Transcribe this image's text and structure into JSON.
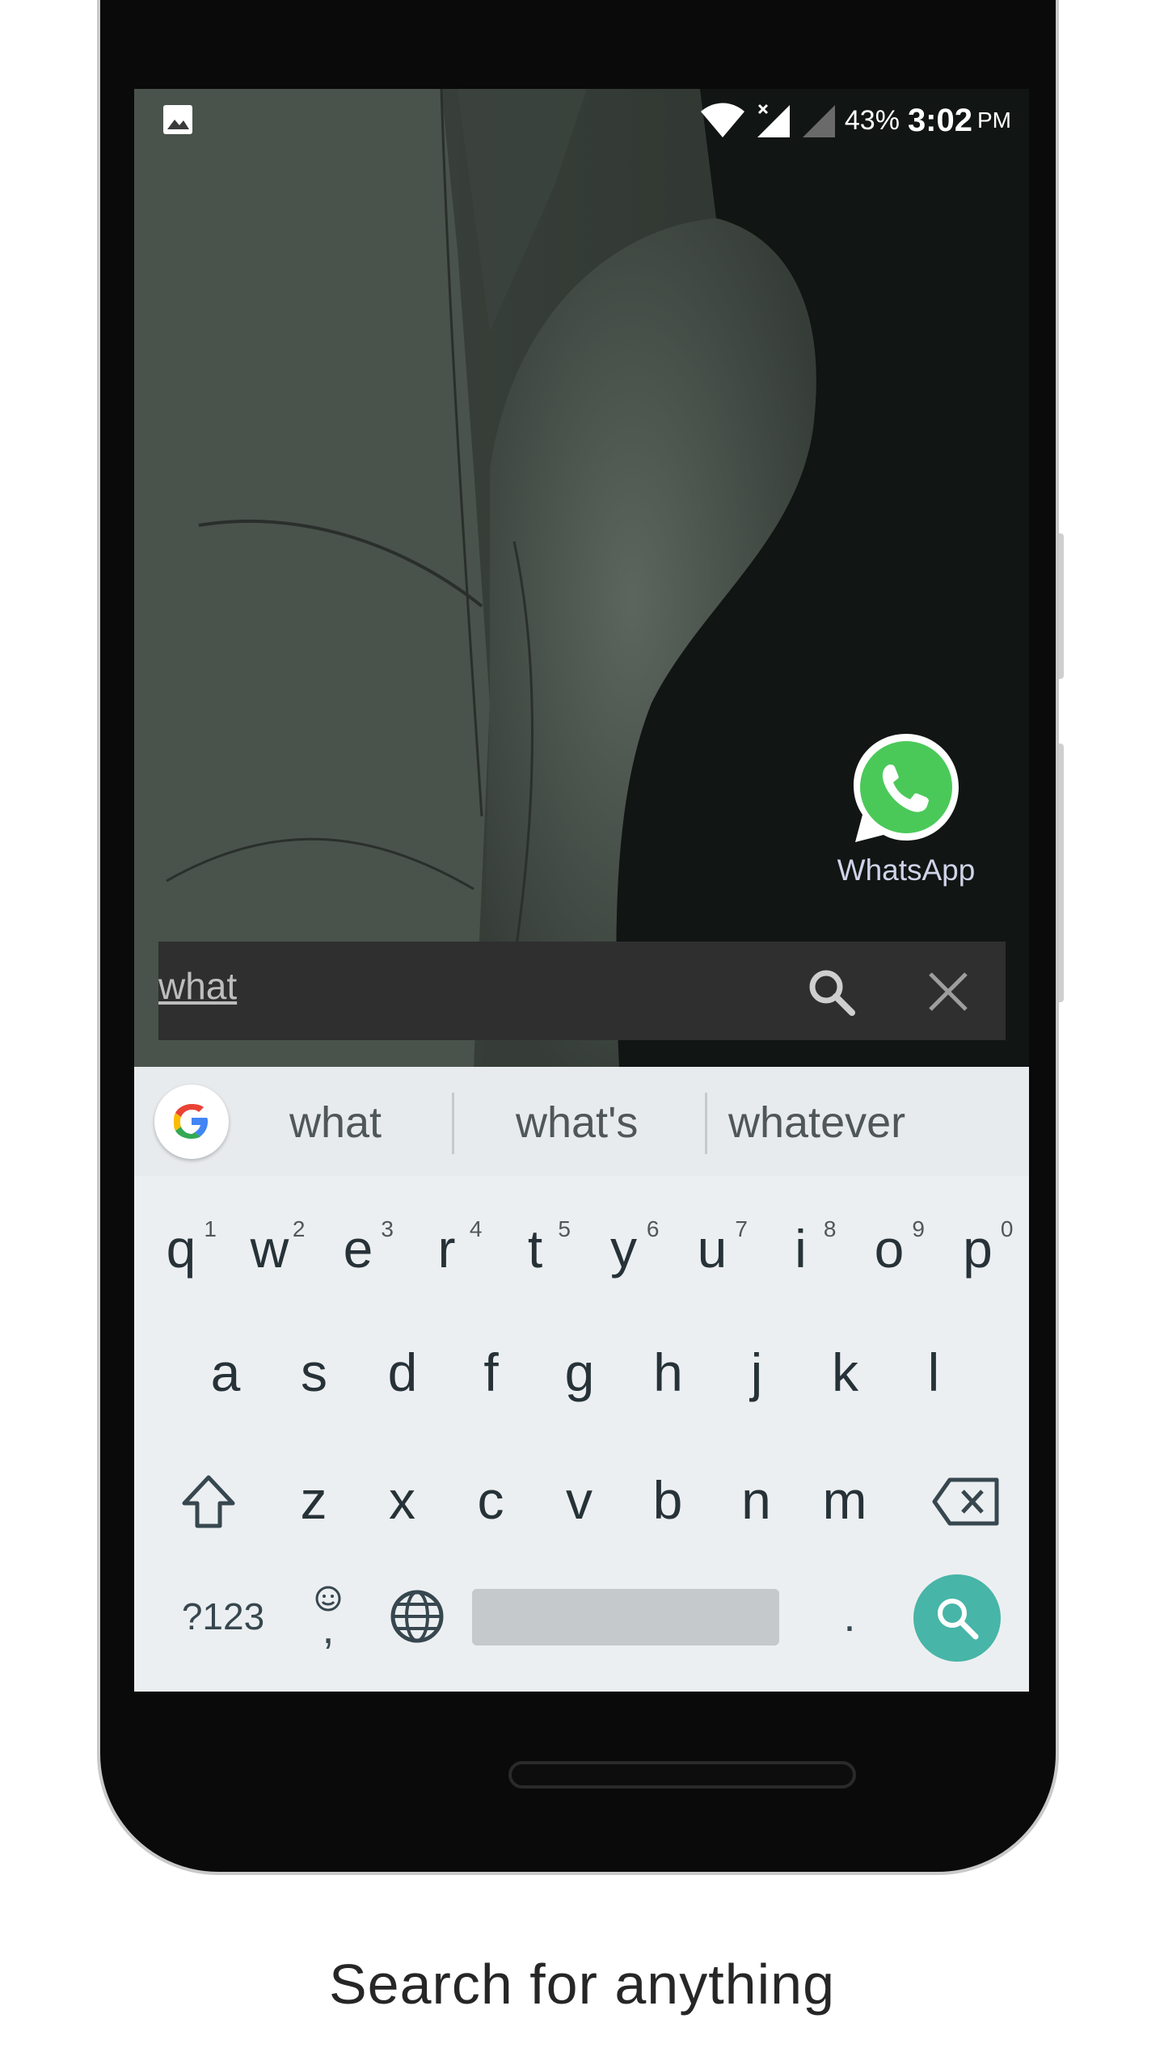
{
  "status_bar": {
    "battery": "43%",
    "time": "3:02",
    "ampm": "PM"
  },
  "home": {
    "app_label": "WhatsApp"
  },
  "search": {
    "query": "what"
  },
  "keyboard": {
    "suggestions": [
      "what",
      "what's",
      "whatever"
    ],
    "row1": [
      {
        "k": "q",
        "h": "1"
      },
      {
        "k": "w",
        "h": "2"
      },
      {
        "k": "e",
        "h": "3"
      },
      {
        "k": "r",
        "h": "4"
      },
      {
        "k": "t",
        "h": "5"
      },
      {
        "k": "y",
        "h": "6"
      },
      {
        "k": "u",
        "h": "7"
      },
      {
        "k": "i",
        "h": "8"
      },
      {
        "k": "o",
        "h": "9"
      },
      {
        "k": "p",
        "h": "0"
      }
    ],
    "row2": [
      "a",
      "s",
      "d",
      "f",
      "g",
      "h",
      "j",
      "k",
      "l"
    ],
    "row3": [
      "z",
      "x",
      "c",
      "v",
      "b",
      "n",
      "m"
    ],
    "symbols_label": "?123",
    "comma": ",",
    "period": "."
  },
  "caption": "Search for anything",
  "colors": {
    "keyboard_bg": "#eceff1",
    "enter_key": "#47b5a7",
    "whatsapp_green": "#4ac959"
  }
}
